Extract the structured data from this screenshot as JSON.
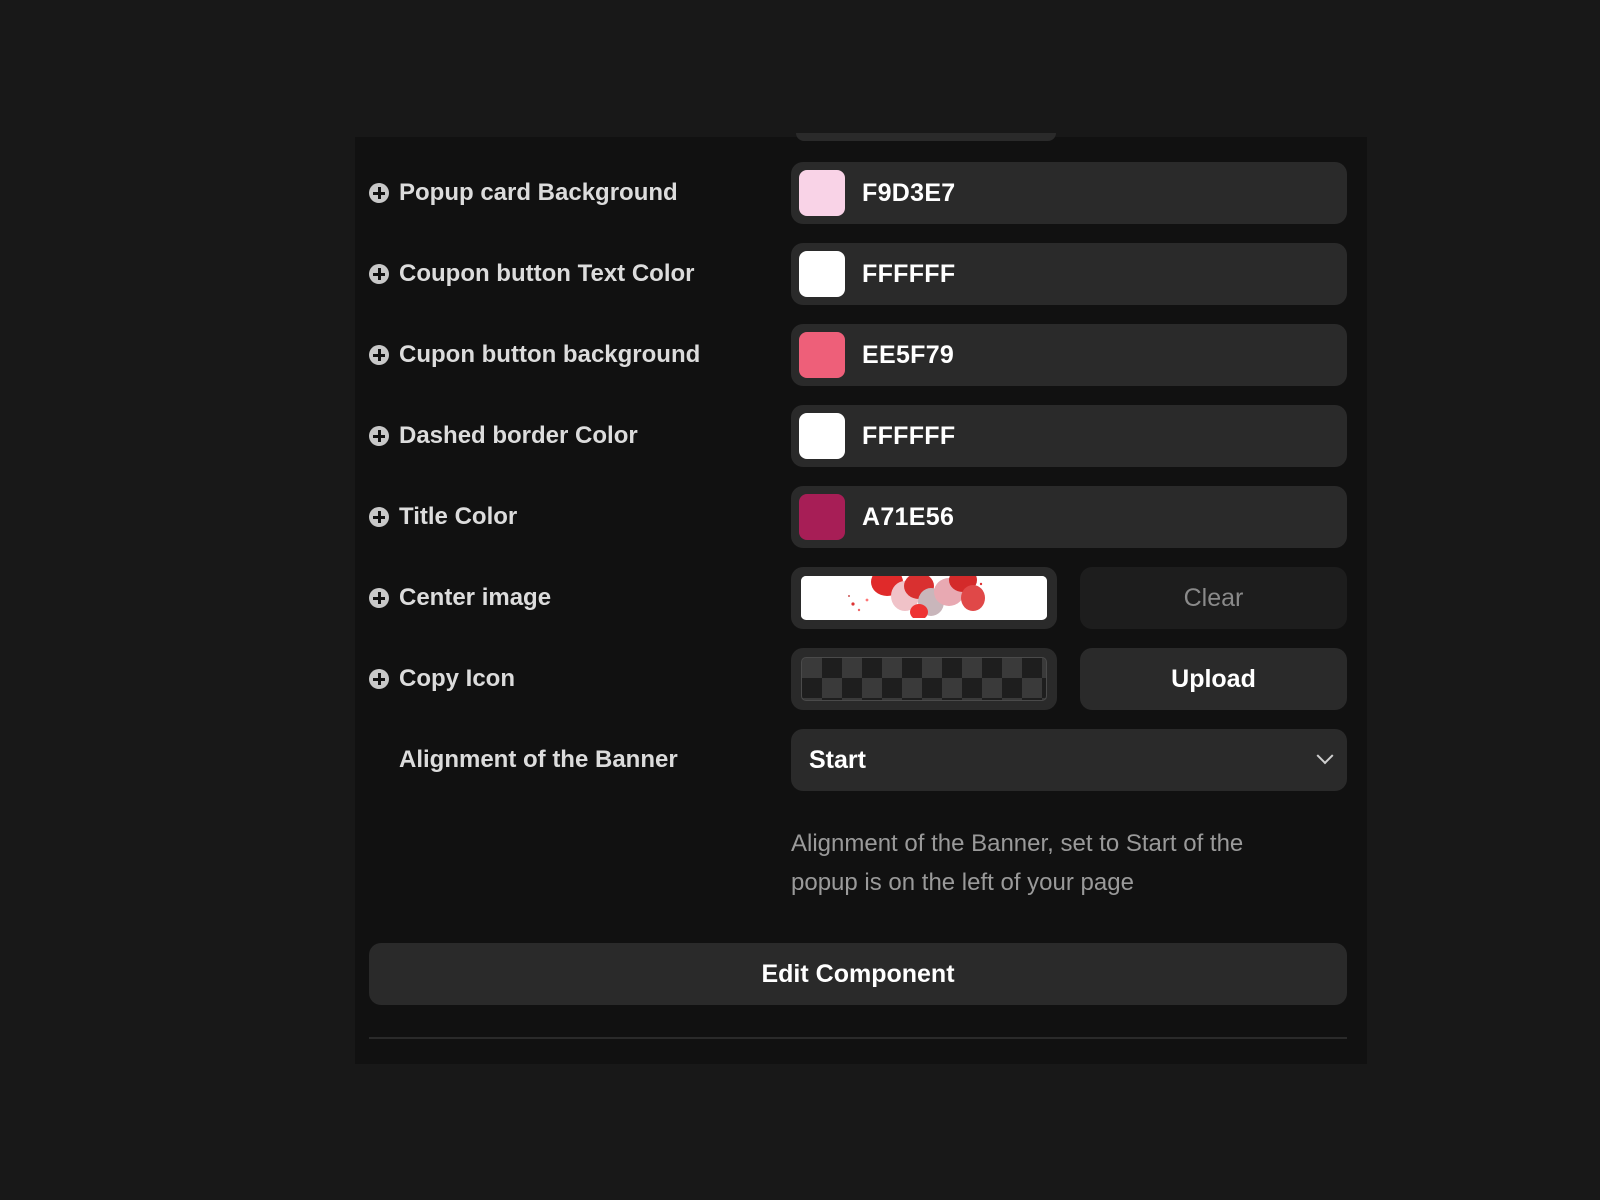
{
  "settings": {
    "rows": [
      {
        "label": "Popup card Background",
        "type": "color",
        "hex": "F9D3E7",
        "swatch": "#F9D3E7"
      },
      {
        "label": "Coupon button Text Color",
        "type": "color",
        "hex": "FFFFFF",
        "swatch": "#FFFFFF"
      },
      {
        "label": "Cupon button background",
        "type": "color",
        "hex": "EE5F79",
        "swatch": "#EE5F79"
      },
      {
        "label": "Dashed border Color",
        "type": "color",
        "hex": "FFFFFF",
        "swatch": "#FFFFFF"
      },
      {
        "label": "Title Color",
        "type": "color",
        "hex": "A71E56",
        "swatch": "#A71E56"
      },
      {
        "label": "Center image",
        "type": "image",
        "button_label": "Clear"
      },
      {
        "label": "Copy Icon",
        "type": "image-empty",
        "button_label": "Upload"
      }
    ],
    "alignment": {
      "label": "Alignment of the Banner",
      "selected": "Start",
      "help_text": "Alignment of the Banner, set to Start of the popup is on the left of your page"
    },
    "edit_button_label": "Edit Component"
  },
  "colors": {
    "page_background": "#181818",
    "panel_background": "#111111",
    "field_background": "#2A2A2A"
  }
}
